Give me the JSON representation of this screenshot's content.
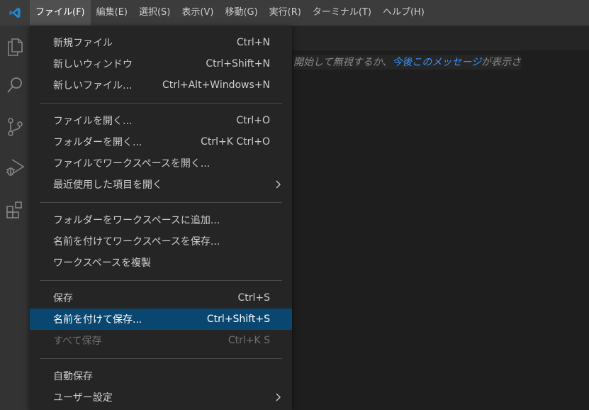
{
  "titlebar": {
    "menus": [
      "ファイル(F)",
      "編集(E)",
      "選択(S)",
      "表示(V)",
      "移動(G)",
      "実行(R)",
      "ターミナル(T)",
      "ヘルプ(H)"
    ]
  },
  "activity_bar": {
    "icons": [
      "explorer-icon",
      "search-icon",
      "source-control-icon",
      "run-debug-icon",
      "extensions-icon"
    ]
  },
  "editor": {
    "line_text_before": "開始して無視するか、",
    "line_link_text": "今後このメッセージ",
    "line_text_after": "が表示さ"
  },
  "file_menu": {
    "groups": [
      [
        {
          "label": "新規ファイル",
          "shortcut": "Ctrl+N"
        },
        {
          "label": "新しいウィンドウ",
          "shortcut": "Ctrl+Shift+N"
        },
        {
          "label": "新しいファイル...",
          "shortcut": "Ctrl+Alt+Windows+N"
        }
      ],
      [
        {
          "label": "ファイルを開く...",
          "shortcut": "Ctrl+O"
        },
        {
          "label": "フォルダーを開く...",
          "shortcut": "Ctrl+K Ctrl+O"
        },
        {
          "label": "ファイルでワークスペースを開く...",
          "shortcut": ""
        },
        {
          "label": "最近使用した項目を開く",
          "shortcut": "",
          "submenu": true
        }
      ],
      [
        {
          "label": "フォルダーをワークスペースに追加...",
          "shortcut": ""
        },
        {
          "label": "名前を付けてワークスペースを保存...",
          "shortcut": ""
        },
        {
          "label": "ワークスペースを複製",
          "shortcut": ""
        }
      ],
      [
        {
          "label": "保存",
          "shortcut": "Ctrl+S"
        },
        {
          "label": "名前を付けて保存...",
          "shortcut": "Ctrl+Shift+S",
          "selected": true
        },
        {
          "label": "すべて保存",
          "shortcut": "Ctrl+K S",
          "disabled": true
        }
      ],
      [
        {
          "label": "自動保存",
          "shortcut": ""
        },
        {
          "label": "ユーザー設定",
          "shortcut": "",
          "submenu": true
        }
      ]
    ]
  },
  "colors": {
    "titlebar_bg": "#3c3c3c",
    "menu_bg": "#252526",
    "selection_bg": "#094771",
    "link": "#3794ff",
    "logo": "#2489ca"
  }
}
